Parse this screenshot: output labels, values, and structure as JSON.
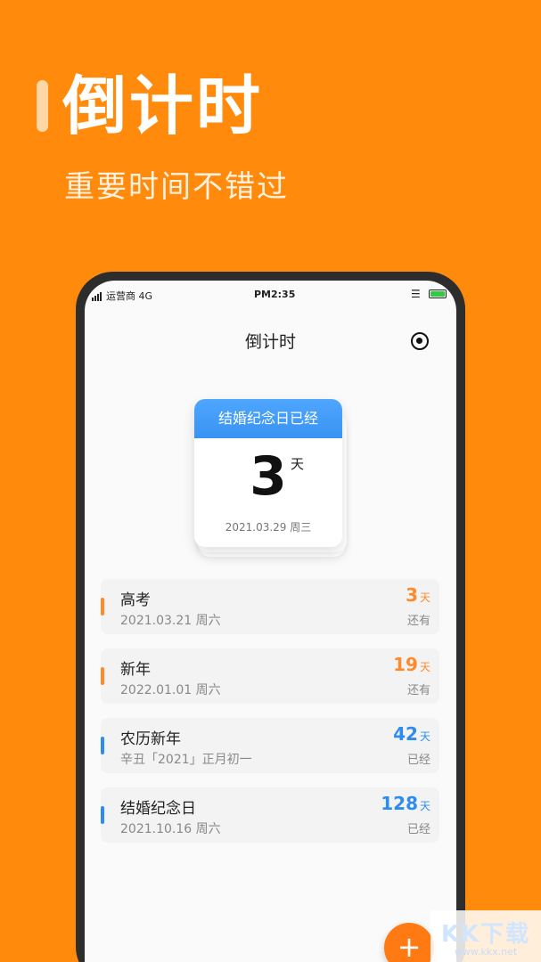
{
  "promo": {
    "title": "倒计时",
    "subtitle": "重要时间不错过"
  },
  "status_bar": {
    "carrier": "运营商 4G",
    "time": "PM2:35"
  },
  "nav": {
    "title": "倒计时"
  },
  "featured": {
    "header": "结婚纪念日已经",
    "count": "3",
    "unit": "天",
    "date": "2021.03.29  周三"
  },
  "events": [
    {
      "name": "高考",
      "date": "2021.03.21 周六",
      "count": "3",
      "unit": "天",
      "status": "还有",
      "color": "#FF8A2B"
    },
    {
      "name": "新年",
      "date": "2022.01.01 周六",
      "count": "19",
      "unit": "天",
      "status": "还有",
      "color": "#FF8A2B"
    },
    {
      "name": "农历新年",
      "date": "辛丑「2021」正月初一",
      "count": "42",
      "unit": "天",
      "status": "已经",
      "color": "#2E8CF0"
    },
    {
      "name": "结婚纪念日",
      "date": "2021.10.16 周六",
      "count": "128",
      "unit": "天",
      "status": "已经",
      "color": "#2E8CF0"
    }
  ],
  "fab": {
    "label": "+"
  },
  "watermark": {
    "text": "KK下载",
    "url": "www.kkx.net"
  },
  "colors": {
    "background": "#FF8A0B",
    "accent_orange": "#FF8A2B",
    "accent_blue": "#2E8CF0"
  }
}
